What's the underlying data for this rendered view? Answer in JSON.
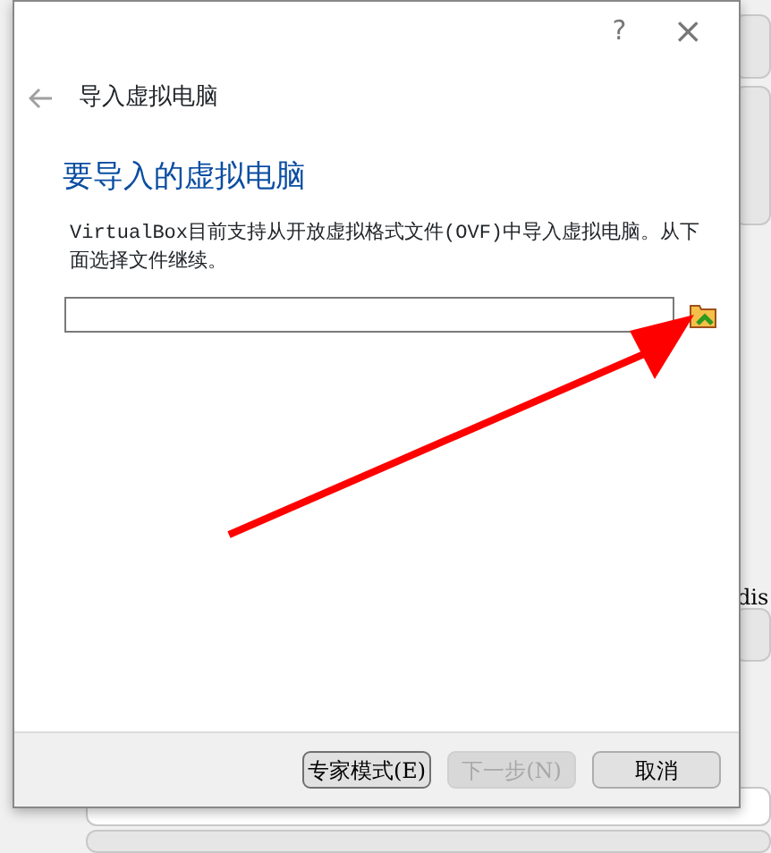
{
  "background_window": {
    "disk_label": "dis"
  },
  "dialog": {
    "help": "?",
    "close": "×",
    "title": "导入虚拟电脑",
    "heading": "要导入的虚拟电脑",
    "description": "VirtualBox目前支持从开放虚拟格式文件(OVF)中导入虚拟电脑。从下面选择文件继续。",
    "buttons": [
      {
        "label": "专家模式(E)",
        "disabled": false,
        "default": true
      },
      {
        "label": "下一步(N)",
        "disabled": true,
        "default": false
      },
      {
        "label": "取消",
        "disabled": false,
        "default": false
      }
    ]
  }
}
